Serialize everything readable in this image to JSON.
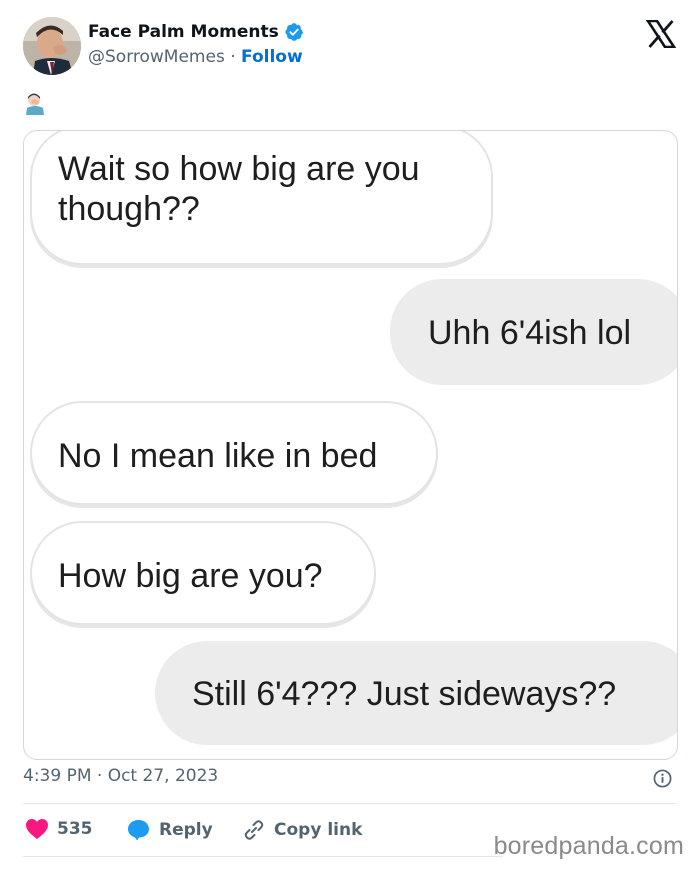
{
  "author": {
    "name": "Face Palm Moments",
    "handle": "@SorrowMemes",
    "separator": "·",
    "follow_label": "Follow"
  },
  "tweet": {
    "emoji": "🤦🏻‍♂️",
    "messages": [
      {
        "side": "in",
        "text_line1": "Wait so how big are you",
        "text_line2": "though??"
      },
      {
        "side": "out",
        "text": "Uhh 6'4ish lol"
      },
      {
        "side": "in",
        "text": "No I mean like in bed"
      },
      {
        "side": "in",
        "text": "How big are you?"
      },
      {
        "side": "out",
        "text": "Still 6'4??? Just sideways??"
      }
    ],
    "timestamp": "4:39 PM · Oct 27, 2023"
  },
  "actions": {
    "likes_count": "535",
    "reply_label": "Reply",
    "copy_link_label": "Copy link"
  },
  "watermark": "boredpanda.com",
  "colors": {
    "link_blue": "#006fd6",
    "like_pink": "#f91880",
    "reply_blue": "#1d9bf0",
    "muted_text": "#536471"
  },
  "icons": [
    "verified-badge-icon",
    "x-logo-icon",
    "info-icon",
    "heart-icon",
    "reply-bubble-icon",
    "link-icon"
  ]
}
